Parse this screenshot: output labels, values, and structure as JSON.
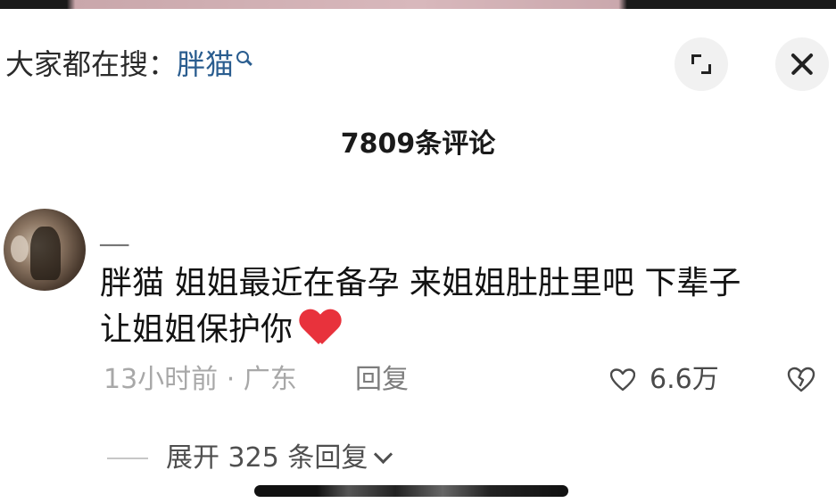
{
  "search_hint": {
    "prefix": "大家都在搜：",
    "keyword": "胖猫",
    "icon": "search-icon"
  },
  "header": {
    "expand_icon": "expand-icon",
    "close_icon": "close-icon",
    "comment_count": "7809条评论"
  },
  "comment": {
    "username": "▔▔▔",
    "line1": "胖猫  姐姐最近在备孕  来姐姐肚肚里吧   下辈子",
    "line2": "让姐姐保护你",
    "emoji": "red-heart-emoji",
    "time_location": "13小时前 · 广东",
    "reply_label": "回复",
    "like_count": "6.6万",
    "expand_replies": "展开 325 条回复"
  },
  "colors": {
    "keyword": "#2a5d8f",
    "heart": "#e8323c",
    "meta_text": "#a8a8a8"
  }
}
